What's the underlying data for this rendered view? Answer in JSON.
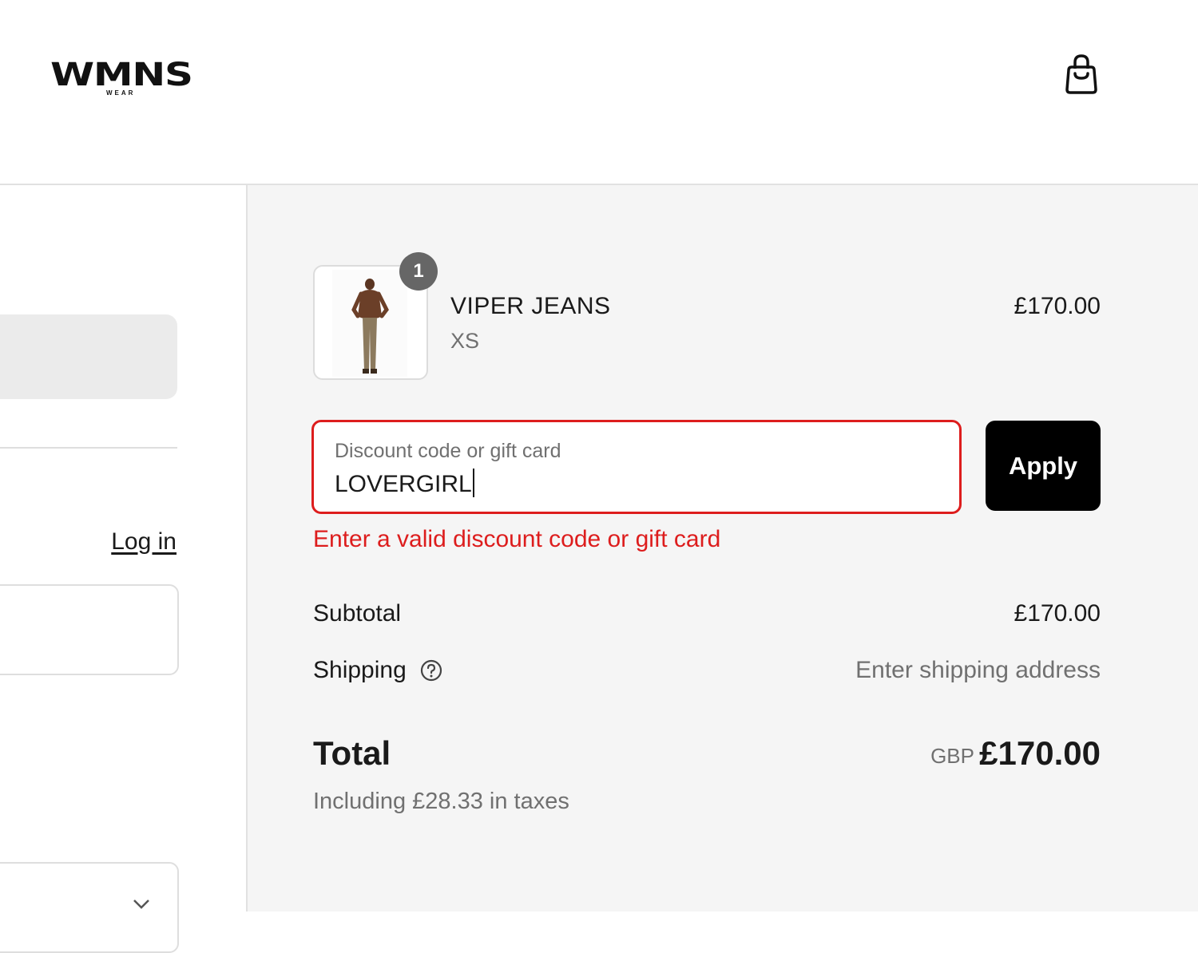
{
  "header": {
    "logo_text": "WMNS",
    "logo_subtext": "WEAR",
    "cart_icon": "shopping-bag-icon"
  },
  "left": {
    "login_label": "Log in"
  },
  "order": {
    "item": {
      "name": "VIPER JEANS",
      "variant": "XS",
      "price": "£170.00",
      "quantity": "1"
    },
    "discount": {
      "label": "Discount code or gift card",
      "value": "LOVERGIRL",
      "apply_label": "Apply",
      "error": "Enter a valid discount code or gift card",
      "error_color": "#dd1d1d"
    },
    "subtotal": {
      "label": "Subtotal",
      "value": "£170.00"
    },
    "shipping": {
      "label": "Shipping",
      "value": "Enter shipping address",
      "help_icon": "question-circle-icon"
    },
    "total": {
      "label": "Total",
      "currency": "GBP",
      "value": "£170.00",
      "taxes": "Including £28.33 in taxes"
    }
  },
  "colors": {
    "accent_button": "#000000",
    "summary_background": "#f5f5f5"
  }
}
